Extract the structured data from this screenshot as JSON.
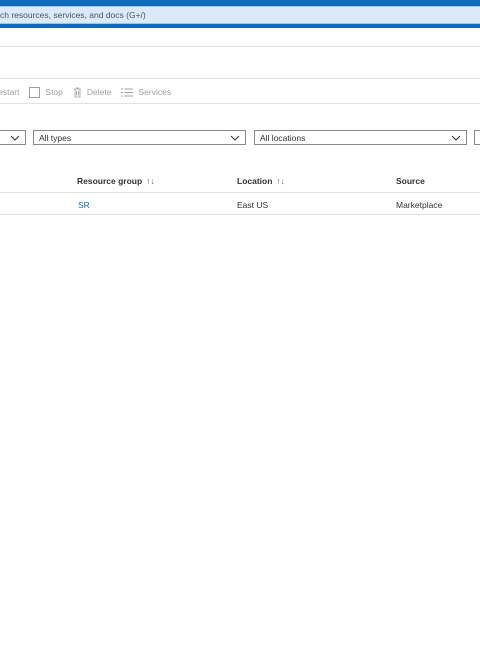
{
  "search": {
    "placeholder": "ch resources, services, and docs (G+/)"
  },
  "toolbar": {
    "restart_label": "Restart",
    "stop_label": "Stop",
    "delete_label": "Delete",
    "services_label": "Services"
  },
  "filters": {
    "types": "All types",
    "locations": "All locations"
  },
  "table": {
    "headers": {
      "resource_group": "Resource group",
      "location": "Location",
      "source": "Source"
    },
    "sort_glyph": "↑↓",
    "rows": [
      {
        "resource_group": "SR",
        "location": "East US",
        "source": "Marketplace"
      }
    ]
  },
  "colors": {
    "accent": "#0f6cbd",
    "search_bg": "#dceaf7"
  }
}
